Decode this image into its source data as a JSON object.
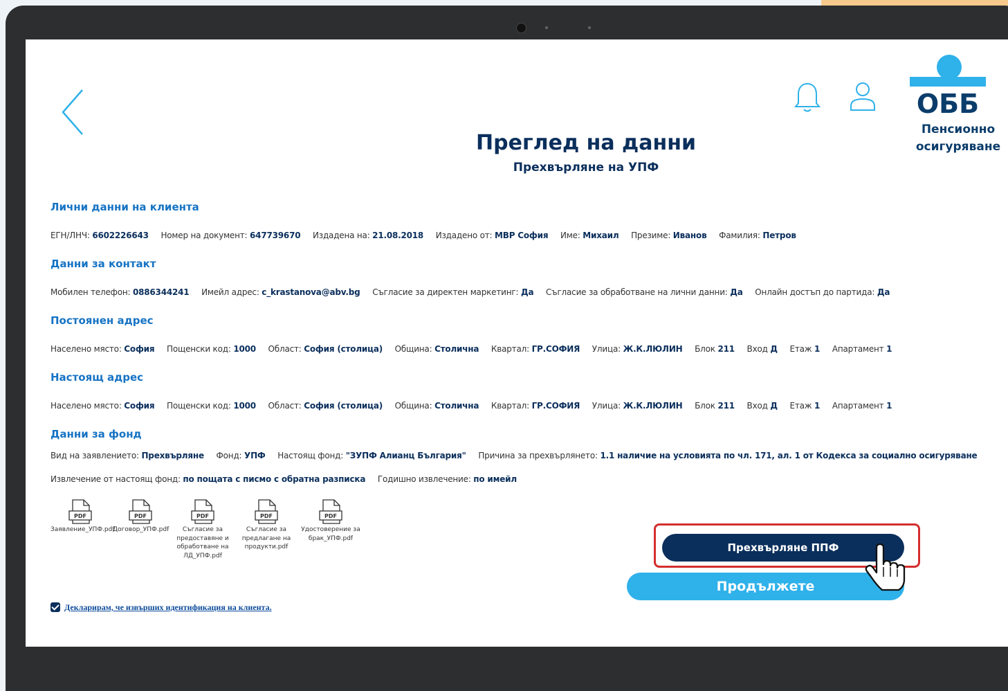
{
  "header": {
    "title": "Преглед на данни",
    "subtitle": "Прехвърляне на УПФ",
    "logo_text": "ОББ",
    "logo_sub1": "Пенсионно",
    "logo_sub2": "осигуряване"
  },
  "sections": {
    "client": {
      "title": "Лични данни на клиента",
      "fields": [
        {
          "label": "ЕГН/ЛНЧ:",
          "value": "6602226643"
        },
        {
          "label": "Номер на документ:",
          "value": "647739670"
        },
        {
          "label": "Издадена на:",
          "value": "21.08.2018"
        },
        {
          "label": "Издадено от:",
          "value": "МВР София"
        },
        {
          "label": "Име:",
          "value": "Михаил"
        },
        {
          "label": "Презиме:",
          "value": "Иванов"
        },
        {
          "label": "Фамилия:",
          "value": "Петров"
        }
      ]
    },
    "contact": {
      "title": "Данни за контакт",
      "fields": [
        {
          "label": "Мобилен телефон:",
          "value": "0886344241"
        },
        {
          "label": "Имейл адрес:",
          "value": "c_krastanova@abv.bg"
        },
        {
          "label": "Съгласие за директен маркетинг:",
          "value": "Да"
        },
        {
          "label": "Съгласие за обработване на лични данни:",
          "value": "Да"
        },
        {
          "label": "Онлайн достъп до партида:",
          "value": "Да"
        }
      ]
    },
    "permanent": {
      "title": "Постоянен адрес",
      "fields": [
        {
          "label": "Населено място:",
          "value": "София"
        },
        {
          "label": "Пощенски код:",
          "value": "1000"
        },
        {
          "label": "Област:",
          "value": "София (столица)"
        },
        {
          "label": "Община:",
          "value": "Столична"
        },
        {
          "label": "Квартал:",
          "value": "ГР.СОФИЯ"
        },
        {
          "label": "Улица:",
          "value": "Ж.К.ЛЮЛИН"
        },
        {
          "label": "Блок",
          "value": "211"
        },
        {
          "label": "Вход",
          "value": "Д"
        },
        {
          "label": "Етаж",
          "value": "1"
        },
        {
          "label": "Апартамент",
          "value": "1"
        }
      ]
    },
    "current": {
      "title": "Настоящ адрес",
      "fields": [
        {
          "label": "Населено място:",
          "value": "София"
        },
        {
          "label": "Пощенски код:",
          "value": "1000"
        },
        {
          "label": "Област:",
          "value": "София (столица)"
        },
        {
          "label": "Община:",
          "value": "Столична"
        },
        {
          "label": "Квартал:",
          "value": "ГР.СОФИЯ"
        },
        {
          "label": "Улица:",
          "value": "Ж.К.ЛЮЛИН"
        },
        {
          "label": "Блок",
          "value": "211"
        },
        {
          "label": "Вход",
          "value": "Д"
        },
        {
          "label": "Етаж",
          "value": "1"
        },
        {
          "label": "Апартамент",
          "value": "1"
        }
      ]
    },
    "fund": {
      "title": "Данни за фонд",
      "row1": [
        {
          "label": "Вид на заявлението:",
          "value": "Прехвърляне"
        },
        {
          "label": "Фонд:",
          "value": "УПФ"
        },
        {
          "label": "Настоящ фонд:",
          "value": "\"ЗУПФ Алианц България\""
        },
        {
          "label": "Причина за прехвърлянето:",
          "value": "1.1 наличие на условията по чл. 171, ал. 1 от Кодекса за социално осигуряване"
        }
      ],
      "row2": [
        {
          "label": "Извлечение от настоящ фонд:",
          "value": "по пощата с писмо с обратна разписка"
        },
        {
          "label": "Годишно извлечение:",
          "value": "по имейл"
        }
      ]
    }
  },
  "files": [
    {
      "icon_label": "PDF",
      "name": "Заявление_УПФ.pdf"
    },
    {
      "icon_label": "PDF",
      "name": "Договор_УПФ.pdf"
    },
    {
      "icon_label": "PDF",
      "name": "Съгласие за предоставяне и обработване на ЛД_УПФ.pdf"
    },
    {
      "icon_label": "PDF",
      "name": "Съгласие за предлагане на продукти.pdf"
    },
    {
      "icon_label": "PDF",
      "name": "Удостоверение за брак_УПФ.pdf"
    }
  ],
  "buttons": {
    "transfer": "Прехвърляне ППФ",
    "continue": "Продължете"
  },
  "declaration": "Декларирам, че извърших идентификация на клиента.",
  "colors": {
    "primary": "#0b2f5c",
    "accent": "#2fb1ea",
    "section": "#1673c4",
    "highlight": "#d42e2e"
  }
}
